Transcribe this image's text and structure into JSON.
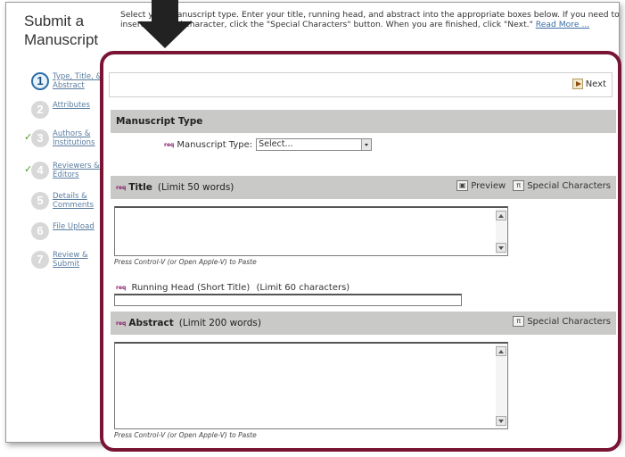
{
  "header": {
    "title_line1": "Submit a",
    "title_line2": "Manuscript",
    "instructions": "Select your manuscript type. Enter your title, running head, and abstract into the appropriate boxes below. If you need to insert a special character, click the \"Special Characters\" button. When you are finished, click \"Next.\"",
    "read_more": "Read More ..."
  },
  "steps": [
    {
      "number": "1",
      "label": "Type, Title, & Abstract",
      "state": "active",
      "checked": false
    },
    {
      "number": "2",
      "label": "Attributes",
      "state": "pending",
      "checked": false
    },
    {
      "number": "3",
      "label": "Authors & Institutions",
      "state": "pending",
      "checked": true
    },
    {
      "number": "4",
      "label": "Reviewers & Editors",
      "state": "pending",
      "checked": true
    },
    {
      "number": "5",
      "label": "Details & Comments",
      "state": "pending",
      "checked": false
    },
    {
      "number": "6",
      "label": "File Upload",
      "state": "pending",
      "checked": false
    },
    {
      "number": "7",
      "label": "Review & Submit",
      "state": "pending",
      "checked": false
    }
  ],
  "toolbar": {
    "next_label": "Next"
  },
  "manuscript_type": {
    "section_title": "Manuscript Type",
    "req": "req",
    "field_label": "Manuscript Type:",
    "selected": "Select..."
  },
  "title_section": {
    "req": "req",
    "label": "Title",
    "limit": "(Limit 50 words)",
    "preview_label": "Preview",
    "special_chars_label": "Special Characters",
    "paste_hint": "Press Control-V (or Open Apple-V) to Paste"
  },
  "running_head": {
    "req": "req",
    "label": "Running Head (Short Title)",
    "limit": "(Limit 60 characters)",
    "value": ""
  },
  "abstract_section": {
    "req": "req",
    "label": "Abstract",
    "limit": "(Limit 200 words)",
    "special_chars_label": "Special Characters",
    "paste_hint": "Press Control-V (or Open Apple-V) to Paste"
  },
  "colors": {
    "highlight_border": "#7a1434",
    "section_header_bg": "#c9c9c7",
    "active_step": "#2f6fa7",
    "check": "#4a9a2a"
  }
}
